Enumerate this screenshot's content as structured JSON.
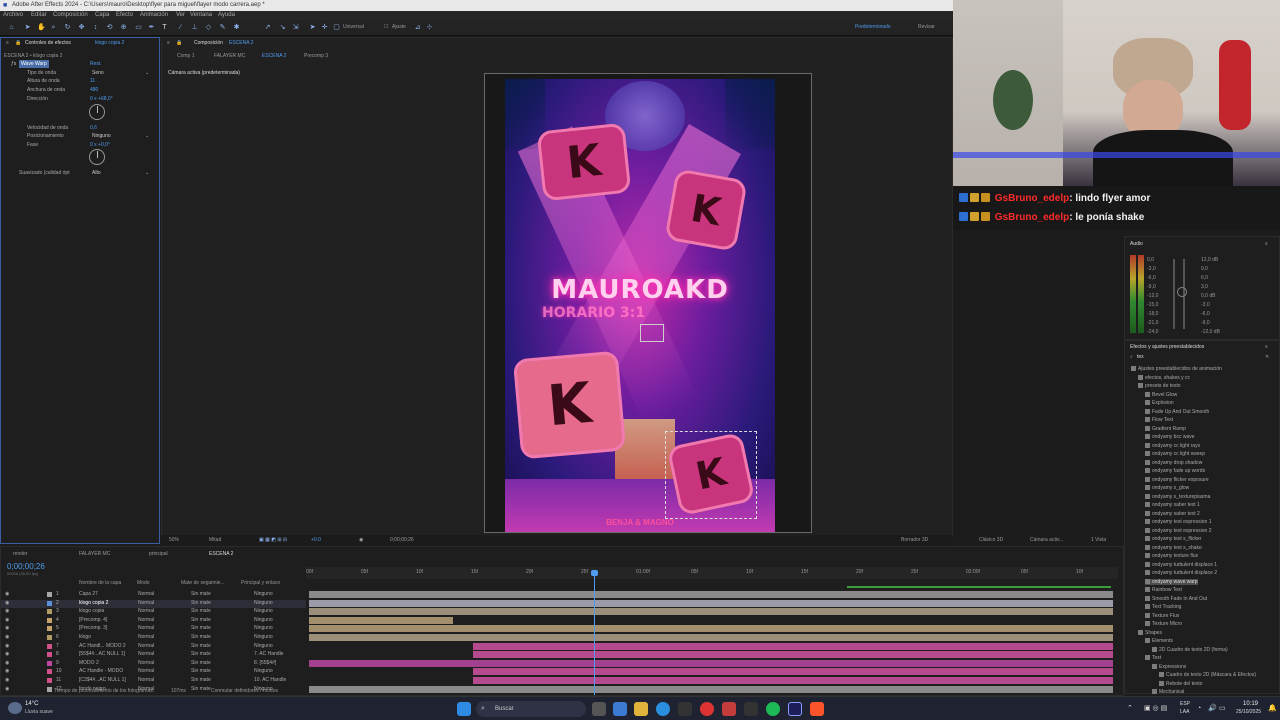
{
  "titlebar": {
    "title": "Adobe After Effects 2024 - C:\\Users\\mauro\\Desktop\\flyer para miguel\\flayer modo carrera.aep *"
  },
  "menu": [
    "Archivo",
    "Editar",
    "Composición",
    "Capa",
    "Efecto",
    "Animación",
    "Ver",
    "Ventana",
    "Ayuda"
  ],
  "toolbar": {
    "universal": "Universal",
    "ajuste": "Ajuste",
    "workspace": "Predeterminado",
    "review": "Revisar"
  },
  "effects_panel": {
    "tab": "Controles de efectos",
    "layer_link": "klogo copia 2",
    "breadcrumb": "ESCENA 2 • klogo copia 2",
    "effect_name": "Wave Warp",
    "reset": "Rest.",
    "props": [
      {
        "label": "Tipo de onda",
        "value": "Seno"
      },
      {
        "label": "Altura de onda",
        "value": "11"
      },
      {
        "label": "Anchura de onda",
        "value": "480"
      },
      {
        "label": "Dirección",
        "value": "0 x +68,0°"
      },
      {
        "label": "Velocidad de onda",
        "value": "0,6"
      },
      {
        "label": "Posicionamiento",
        "value": "Ninguno"
      },
      {
        "label": "Fase",
        "value": "0 x +0,0°"
      },
      {
        "label": "Suavizado (calidad ópt",
        "value": "Alto"
      }
    ]
  },
  "comp_panel": {
    "tab_label": "Composición",
    "tab_name": "ESCENA 2",
    "subtabs": [
      "Comp 1",
      "FALAYER MC",
      "ESCENA 2",
      "Precomp 3"
    ],
    "camera": "Cámara activa (predeterminada)",
    "bottom": {
      "zoom": "50%",
      "resolution": "Mitad",
      "timecode": "0;00;00;26",
      "renderer": "Borrador 3D",
      "renderer_mode": "Clásico 3D",
      "camera": "Cámara activ...",
      "views": "1 Vista"
    }
  },
  "artwork": {
    "title": "MAUROAKD",
    "subtitle": "HORARIO 3:1",
    "footer": "BENJA & MAGNO",
    "sticker_letter": "K"
  },
  "chat": [
    {
      "user": "GsBruno_edelp",
      "msg": ": lindo flyer amor"
    },
    {
      "user": "GsBruno_edelp",
      "msg": ": le ponía shake"
    }
  ],
  "audio_panel": {
    "title": "Audio",
    "left_scale": [
      "0,0",
      "-3,0",
      "-6,0",
      "-9,0",
      "-12,0",
      "-15,0",
      "-18,0",
      "-21,0",
      "-24,0"
    ],
    "right_scale": [
      "12,0 dB",
      "9,0",
      "6,0",
      "3,0",
      "0,0 dB",
      "-3,0",
      "-6,0",
      "-9,0",
      "-12,0 dB"
    ]
  },
  "presets_panel": {
    "title": "Efectos y ajustes preestablecidos",
    "search": "tex",
    "tree": [
      "Ajustes preestablecidos de animación",
      "efectos, shakes y cc",
      "presets de texto",
      "Bevel Glow",
      "Explosion",
      "Fade Up And Out Smooth",
      "Flow Text",
      "Gradient Ramp",
      "ondyamy bcc wave",
      "ondyamy cc light rays",
      "ondyamy cc light sweep",
      "ondyamy drop shadow",
      "ondyamy fade up words",
      "ondyamy flicker exposure",
      "ondyamy s_glow",
      "ondyamy s_texturepiasma",
      "ondyamy saber text 1",
      "ondyamy saber text 2",
      "ondyamy text expression 1",
      "ondyamy text expression 2",
      "ondyamy text s_flicker",
      "ondyamy text s_shake",
      "ondyamy texture flux",
      "ondyamy turbulent displace 1",
      "ondyamy turbulent displace 2",
      "ondyamy wave warp",
      "Rainbow Text",
      "Smooth Fade In And Out",
      "Text Tracking",
      "Texture Flux",
      "Texture Micro",
      "Shapes",
      "Elements",
      "2D Cuadro de texto 2D (forma)",
      "Text",
      "Expressions",
      "Cuadro de texto 2D (Máscara & Efectos)",
      "Rebote del texto",
      "Mechanical"
    ]
  },
  "timeline": {
    "tabs": [
      "render",
      "FALAYER MC",
      "principal",
      "ESCENA 2"
    ],
    "timecode": "0;00;00;26",
    "fps": "00026 (30,00 fps)",
    "headers": {
      "name": "Nombre de la capa",
      "mode": "Modo",
      "track": "Mate de seguimie...",
      "parent": "Principal y enlace"
    },
    "ruler": [
      "00f",
      "05f",
      "10f",
      "15f",
      "20f",
      "25f",
      "01:00f",
      "05f",
      "10f",
      "15f",
      "20f",
      "25f",
      "02:00f",
      "05f",
      "10f"
    ],
    "layers": [
      {
        "num": "1",
        "name": "Capa 27",
        "mode": "Normal",
        "track": "Sin mate",
        "parent": "Ninguno"
      },
      {
        "num": "2",
        "name": "klogo copia 2",
        "mode": "Normal",
        "track": "Sin mate",
        "parent": "Ninguno"
      },
      {
        "num": "3",
        "name": "klogo copia",
        "mode": "Normal",
        "track": "Sin mate",
        "parent": "Ninguno"
      },
      {
        "num": "4",
        "name": "[Precomp. 4]",
        "mode": "Normal",
        "track": "Sin mate",
        "parent": "Ninguno"
      },
      {
        "num": "5",
        "name": "[Precomp. 3]",
        "mode": "Normal",
        "track": "Sin mate",
        "parent": "Ninguno"
      },
      {
        "num": "6",
        "name": "klogo",
        "mode": "Normal",
        "track": "Sin mate",
        "parent": "Ninguno"
      },
      {
        "num": "7",
        "name": "AC Handl... MODO 2",
        "mode": "Normal",
        "track": "Sin mate",
        "parent": "Ninguno"
      },
      {
        "num": "8",
        "name": "[55$4#...AC NULL 1]",
        "mode": "Normal",
        "track": "Sin mate",
        "parent": "7. AC Handle"
      },
      {
        "num": "9",
        "name": "MODO 2",
        "mode": "Normal",
        "track": "Sin mate",
        "parent": "8. [55$4#]"
      },
      {
        "num": "10",
        "name": "AC Handle - MODO",
        "mode": "Normal",
        "track": "Sin mate",
        "parent": "Ninguno"
      },
      {
        "num": "11",
        "name": "[C3$4#...AC NULL 1]",
        "mode": "Normal",
        "track": "Sin mate",
        "parent": "10. AC Handle"
      },
      {
        "num": "12",
        "name": "fondo negro",
        "mode": "Normal",
        "track": "Sin mate",
        "parent": "Ninguno"
      }
    ],
    "status_left": "Tiempo de procesamiento de los fotogramas:",
    "status_time": "107ms",
    "status_toggle": "Conmutar definidores / modos"
  },
  "taskbar": {
    "weather_temp": "14°C",
    "weather_desc": "Lluvia suave",
    "search": "Buscar",
    "lang1": "ESP",
    "lang2": "LAA",
    "time": "10:19",
    "date": "25/10/2025"
  }
}
